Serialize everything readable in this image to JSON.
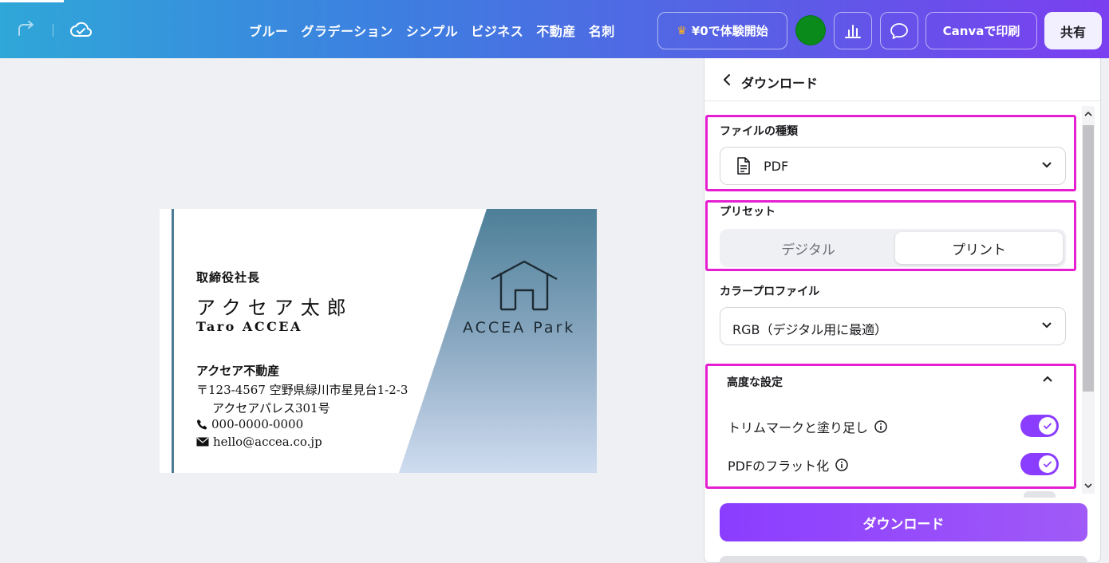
{
  "topbar": {
    "nav": [
      "ブルー",
      "グラデーション",
      "シンプル",
      "ビジネス",
      "不動産",
      "名刺"
    ],
    "trial_label": "¥0で体験開始",
    "print_label": "Canvaで印刷",
    "share_label": "共有",
    "avatar_color": "#0a8a1a"
  },
  "card": {
    "title": "取締役社長",
    "name": "アクセア太郎",
    "name_roman": "Taro ACCEA",
    "company": "アクセア不動産",
    "address1": "〒123-4567 空野県緑川市星見台1-2-3",
    "address2": "アクセアパレス301号",
    "phone": "000-0000-0000",
    "email": "hello@accea.co.jp",
    "logo_text": "ACCEA Park"
  },
  "panel": {
    "title": "ダウンロード",
    "file_type": {
      "label": "ファイルの種類",
      "value": "PDF"
    },
    "preset": {
      "label": "プリセット",
      "options": [
        "デジタル",
        "プリント"
      ],
      "selected": "プリント"
    },
    "color_profile": {
      "label": "カラープロファイル",
      "value": "RGB（デジタル用に最適）"
    },
    "advanced": {
      "title": "高度な設定",
      "options": [
        {
          "label": "トリムマークと塗り足し",
          "on": true
        },
        {
          "label": "PDFのフラット化",
          "on": true
        }
      ]
    },
    "download_label": "ダウンロード"
  },
  "colors": {
    "accent": "#8b3dff",
    "highlight": "#e61ed1"
  }
}
